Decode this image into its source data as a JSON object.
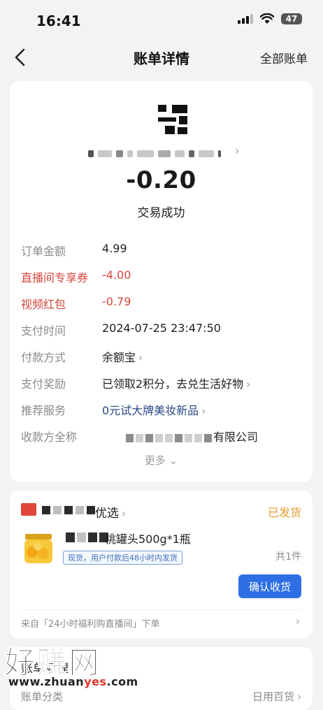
{
  "status_bar": {
    "time": "16:41",
    "battery": "47"
  },
  "nav": {
    "title": "账单详情",
    "right_link": "全部账单"
  },
  "summary": {
    "amount": "-0.20",
    "status": "交易成功"
  },
  "details": [
    {
      "label": "订单金额",
      "value": "4.99",
      "highlight": false
    },
    {
      "label": "直播间专享券",
      "value": "-4.00",
      "highlight": true
    },
    {
      "label": "视频红包",
      "value": "-0.79",
      "highlight": true
    },
    {
      "label": "支付时间",
      "value": "2024-07-25 23:47:50",
      "highlight": false
    },
    {
      "label": "付款方式",
      "value": "余额宝",
      "highlight": false
    },
    {
      "label": "支付奖励",
      "value": "已领取2积分，去兑生活好物",
      "highlight": false
    },
    {
      "label": "推荐服务",
      "value": "0元试大牌美妆新品",
      "highlight": false
    },
    {
      "label": "收款方全称",
      "value": "有限公司",
      "highlight": false
    }
  ],
  "more_label": "更多",
  "order": {
    "shop_name": "优选",
    "status": "已发货",
    "product_title": "桃罐头500g*1瓶",
    "delivery_tag": "现货，用户付款后48小时内发货",
    "quantity": "共1件",
    "confirm_button": "确认收货",
    "source": "来自「24小时福利购直播间」下单"
  },
  "bill_section": {
    "title": "账单管理",
    "category_label": "账单分类",
    "category_value": "日用百货"
  },
  "watermark": {
    "text": "好赚网",
    "url_prefix": "www.zhuan",
    "url_highlight": "yes",
    "url_suffix": ".com"
  },
  "colors": {
    "accent_blue": "#2f6fe6",
    "discount_red": "#d4473f",
    "status_orange": "#e69a2e",
    "link_blue": "#2a4a86"
  }
}
